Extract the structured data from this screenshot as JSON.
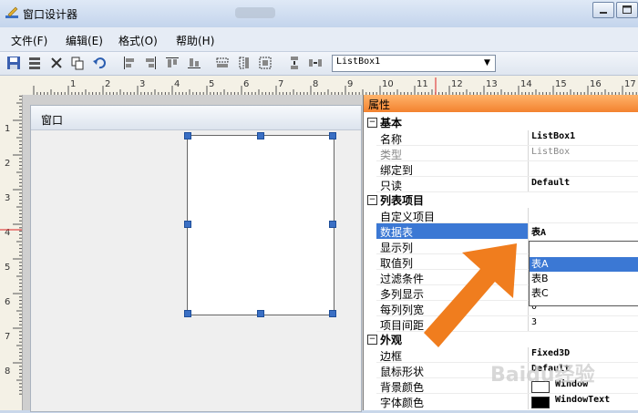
{
  "window": {
    "title": "窗口设计器"
  },
  "menu": {
    "file": "文件(F)",
    "edit": "编辑(E)",
    "format": "格式(O)",
    "help": "帮助(H)"
  },
  "toolbar": {
    "combo_value": "ListBox1"
  },
  "ruler": {
    "h_labels": [
      "1",
      "2",
      "3",
      "4",
      "5",
      "6",
      "7",
      "8",
      "9",
      "10",
      "11",
      "12",
      "13",
      "14",
      "15",
      "16",
      "17"
    ],
    "v_labels": [
      "1",
      "2",
      "3",
      "4",
      "5",
      "6",
      "7",
      "8"
    ]
  },
  "form": {
    "caption": "窗口"
  },
  "props": {
    "header": "属性",
    "basic": {
      "label": "基本",
      "toggle": "⊟",
      "rows": [
        {
          "name": "名称",
          "value": "ListBox1"
        },
        {
          "name": "类型",
          "value": "ListBox"
        },
        {
          "name": "绑定到",
          "value": ""
        },
        {
          "name": "只读",
          "value": "Default"
        }
      ]
    },
    "list": {
      "label": "列表项目",
      "toggle": "⊟",
      "rows": [
        {
          "name": "自定义项目",
          "value": ""
        },
        {
          "name": "数据表",
          "value": "表A"
        },
        {
          "name": "显示列",
          "value": ""
        },
        {
          "name": "取值列",
          "value": ""
        },
        {
          "name": "过滤条件",
          "value": ""
        },
        {
          "name": "多列显示",
          "value": ""
        },
        {
          "name": "每列列宽",
          "value": "0"
        },
        {
          "name": "项目间距",
          "value": "3"
        }
      ]
    },
    "appearance": {
      "label": "外观",
      "toggle": "⊟",
      "rows": [
        {
          "name": "边框",
          "value": "Fixed3D"
        },
        {
          "name": "鼠标形状",
          "value": "Default"
        },
        {
          "name": "背景颜色",
          "value": "Window"
        },
        {
          "name": "字体颜色",
          "value": "WindowText"
        }
      ]
    },
    "dropdown": [
      "表A",
      "表B",
      "表C"
    ]
  },
  "watermark": "Baidu经验",
  "colors": {
    "accent": "#f07d1e",
    "selection": "#3b78d4",
    "header": "#f3822f"
  }
}
